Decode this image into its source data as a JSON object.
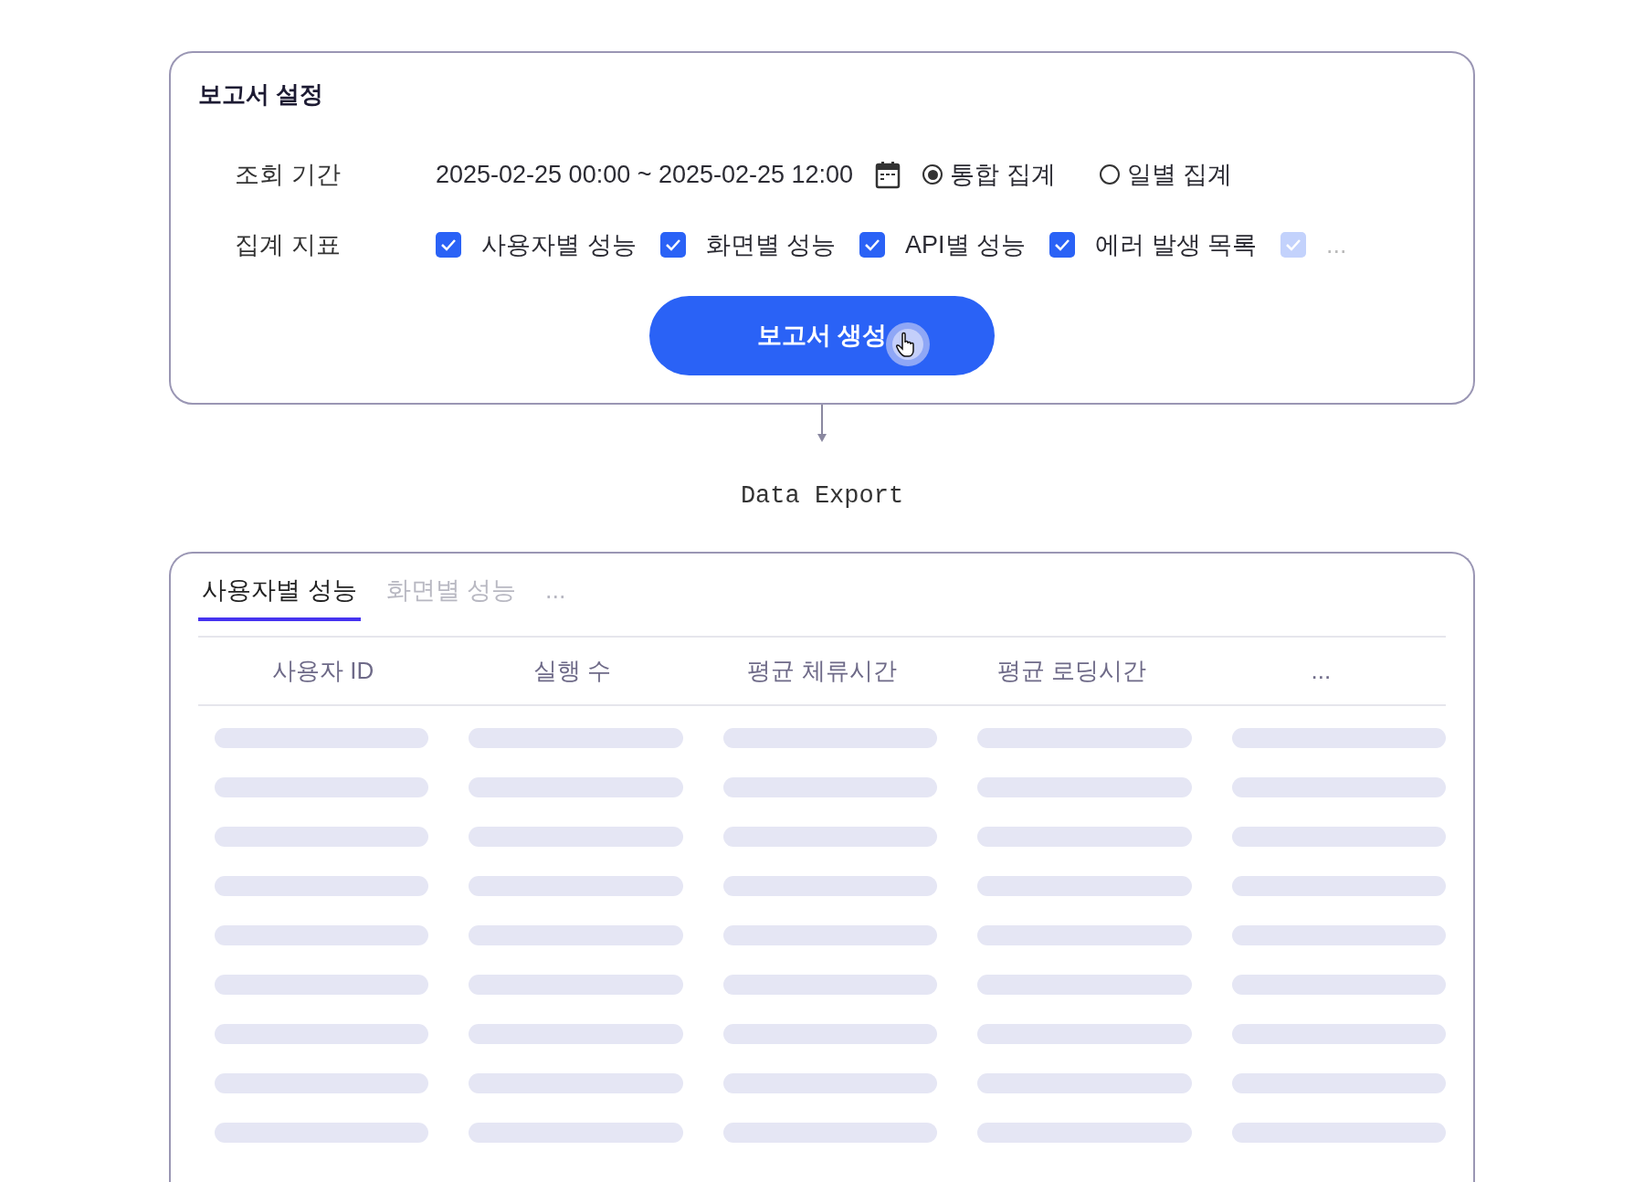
{
  "settings": {
    "title": "보고서 설정",
    "period": {
      "label": "조회 기간",
      "value": "2025-02-25 00:00 ~ 2025-02-25 12:00",
      "modes": [
        {
          "label": "통합 집계",
          "selected": true
        },
        {
          "label": "일별 집계",
          "selected": false
        }
      ]
    },
    "metrics": {
      "label": "집계 지표",
      "options": [
        {
          "label": "사용자별 성능",
          "checked": true,
          "disabled": false
        },
        {
          "label": "화면별 성능",
          "checked": true,
          "disabled": false
        },
        {
          "label": "API별 성능",
          "checked": true,
          "disabled": false
        },
        {
          "label": "에러 발생 목록",
          "checked": true,
          "disabled": false
        },
        {
          "label": "...",
          "checked": true,
          "disabled": true
        }
      ]
    },
    "button": "보고서 생성"
  },
  "flow_label": "Data Export",
  "result": {
    "tabs": [
      {
        "label": "사용자별 성능",
        "selected": true
      },
      {
        "label": "화면별 성능",
        "selected": false
      },
      {
        "label": "...",
        "selected": false
      }
    ],
    "table": {
      "columns": [
        "사용자 ID",
        "실행 수",
        "평균 체류시간",
        "평균 로딩시간",
        "..."
      ]
    }
  }
}
